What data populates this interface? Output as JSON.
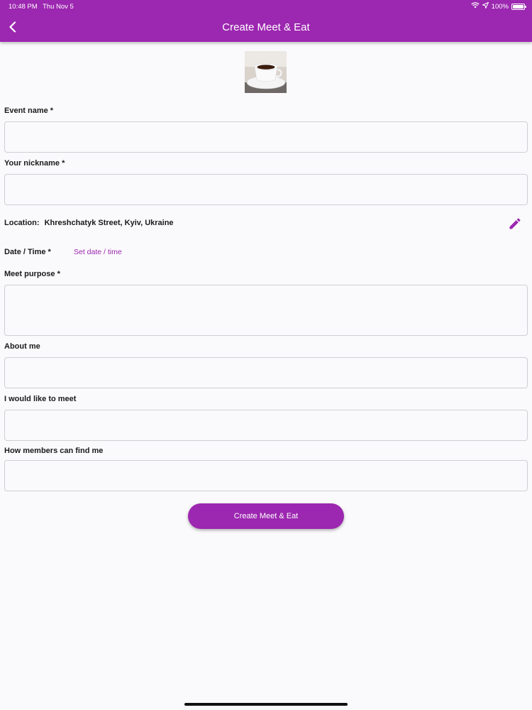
{
  "status_bar": {
    "time": "10:48 PM",
    "date": "Thu Nov 5",
    "battery": "100%"
  },
  "app_bar": {
    "title": "Create Meet & Eat",
    "back_icon": "chevron-left-icon"
  },
  "event_image": {
    "icon": "coffee-cup-photo"
  },
  "form": {
    "event_name": {
      "label": "Event name *",
      "value": "",
      "placeholder": ""
    },
    "nickname": {
      "label": "Your nickname *",
      "value": "",
      "placeholder": ""
    },
    "location": {
      "label": "Location:",
      "value": "Khreshchatyk Street, Kyiv, Ukraine",
      "edit_icon": "pencil-icon"
    },
    "date_time": {
      "label": "Date / Time *",
      "action": "Set date / time"
    },
    "meet_purpose": {
      "label": "Meet purpose *",
      "value": "",
      "placeholder": ""
    },
    "about_me": {
      "label": "About me",
      "value": "",
      "placeholder": ""
    },
    "would_like_to_meet": {
      "label": "I would like to meet",
      "value": "",
      "placeholder": ""
    },
    "how_to_find": {
      "label": "How members can find me",
      "value": "",
      "placeholder": ""
    }
  },
  "submit": {
    "label": "Create Meet & Eat"
  },
  "colors": {
    "primary": "#9c27b0",
    "background": "#faf9fb",
    "border": "#cfcfd4"
  }
}
